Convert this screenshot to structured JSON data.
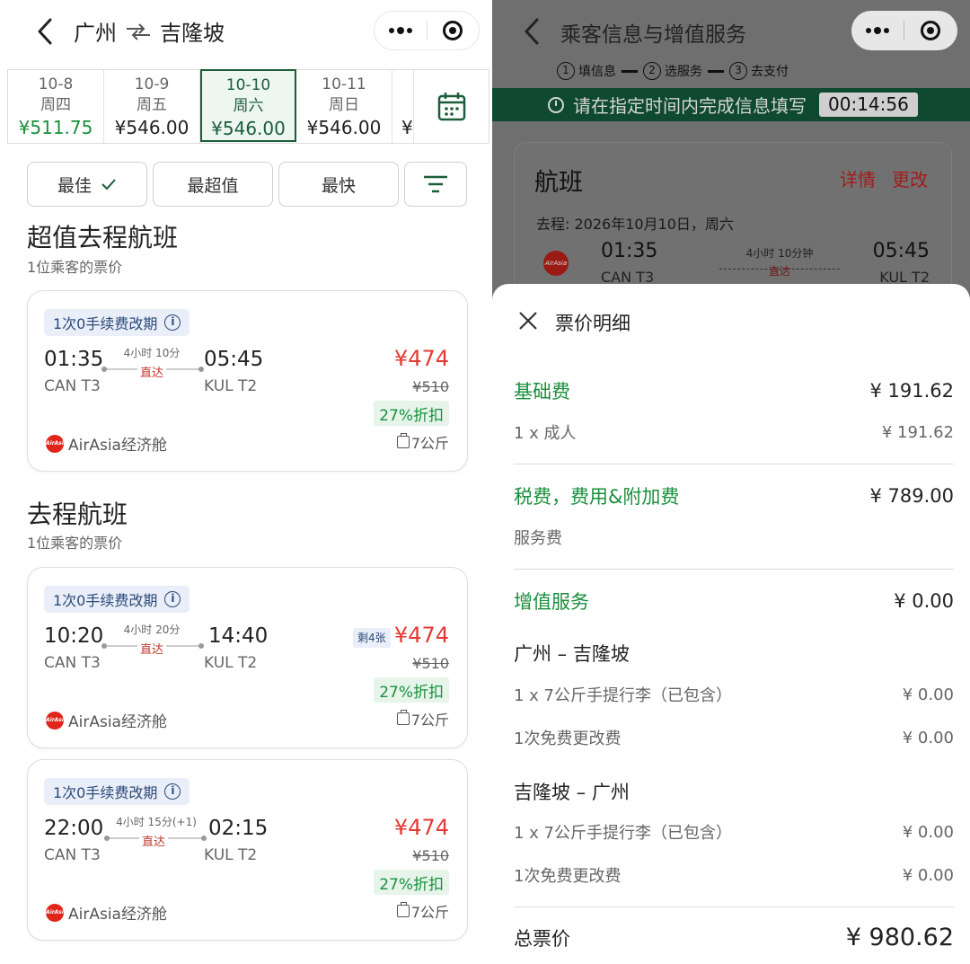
{
  "left": {
    "header": {
      "origin": "广州",
      "destination": "吉隆坡"
    },
    "dates": [
      {
        "date": "10-8",
        "weekday": "周四",
        "price": "¥511.75",
        "lowest": true,
        "selected": false
      },
      {
        "date": "10-9",
        "weekday": "周五",
        "price": "¥546.00",
        "lowest": false,
        "selected": false
      },
      {
        "date": "10-10",
        "weekday": "周六",
        "price": "¥546.00",
        "lowest": false,
        "selected": true
      },
      {
        "date": "10-11",
        "weekday": "周日",
        "price": "¥546.00",
        "lowest": false,
        "selected": false
      }
    ],
    "dates_cut_price": "¥",
    "sort": {
      "best": "最佳",
      "best_value": "最超值",
      "fastest": "最快"
    },
    "section1": {
      "title": "超值去程航班",
      "subtitle": "1位乘客的票价"
    },
    "section2": {
      "title": "去程航班",
      "subtitle": "1位乘客的票价"
    },
    "flights": [
      {
        "badge": "1次0手续费改期",
        "dep_time": "01:35",
        "dep_airport": "CAN T3",
        "duration": "4小时 10分",
        "direct": "直达",
        "arr_time": "05:45",
        "arr_airport": "KUL T2",
        "price": "¥474",
        "original": "¥510",
        "discount": "27%折扣",
        "remaining": "",
        "airline": "AirAsia经济舱",
        "baggage": "7公斤"
      },
      {
        "badge": "1次0手续费改期",
        "dep_time": "10:20",
        "dep_airport": "CAN T3",
        "duration": "4小时 20分",
        "direct": "直达",
        "arr_time": "14:40",
        "arr_airport": "KUL T2",
        "price": "¥474",
        "original": "¥510",
        "discount": "27%折扣",
        "remaining": "剩4张",
        "airline": "AirAsia经济舱",
        "baggage": "7公斤"
      },
      {
        "badge": "1次0手续费改期",
        "dep_time": "22:00",
        "dep_airport": "CAN T3",
        "duration": "4小时 15分(+1)",
        "direct": "直达",
        "arr_time": "02:15",
        "arr_airport": "KUL T2",
        "price": "¥474",
        "original": "¥510",
        "discount": "27%折扣",
        "remaining": "",
        "airline": "AirAsia经济舱",
        "baggage": "7公斤"
      }
    ],
    "airline_logo_text": "AirAsia"
  },
  "right": {
    "header": {
      "title": "乘客信息与增值服务"
    },
    "steps": [
      {
        "num": "1",
        "label": "填信息"
      },
      {
        "num": "2",
        "label": "选服务"
      },
      {
        "num": "3",
        "label": "去支付"
      }
    ],
    "timer": {
      "message": "请在指定时间内完成信息填写",
      "countdown": "00:14:56"
    },
    "flight_card": {
      "title": "航班",
      "details": "详情",
      "change": "更改",
      "date": "去程: 2026年10月10日，周六",
      "dep_time": "01:35",
      "dep_airport": "CAN T3",
      "duration": "4小时 10分钟",
      "direct": "直达",
      "arr_time": "05:45",
      "arr_airport": "KUL T2"
    },
    "sheet": {
      "title": "票价明细",
      "base_fare": {
        "label": "基础费",
        "amount": "¥ 191.62"
      },
      "adult": {
        "label": "1 x 成人",
        "amount": "¥ 191.62"
      },
      "taxes": {
        "label": "税费，费用&附加费",
        "amount": "¥ 789.00"
      },
      "service_fee": {
        "label": "服务费"
      },
      "value_added": {
        "label": "增值服务",
        "amount": "¥ 0.00"
      },
      "segment1": {
        "route": "广州 – 吉隆坡",
        "baggage": {
          "label": "1 x 7公斤手提行李（已包含）",
          "amount": "¥ 0.00"
        },
        "change": {
          "label": "1次免费更改费",
          "amount": "¥ 0.00"
        }
      },
      "segment2": {
        "route": "吉隆坡 – 广州",
        "baggage": {
          "label": "1 x 7公斤手提行李（已包含）",
          "amount": "¥ 0.00"
        },
        "change": {
          "label": "1次免费更改费",
          "amount": "¥ 0.00"
        }
      },
      "total": {
        "label": "总票价",
        "amount": "¥ 980.62"
      }
    }
  },
  "colors": {
    "green": "#1a8f3d",
    "dark_green": "#1b5e3a",
    "red": "#e53935",
    "timer_bg": "#0e4930"
  }
}
